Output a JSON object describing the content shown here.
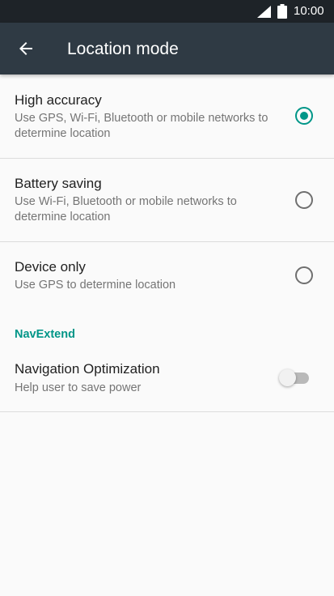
{
  "status_bar": {
    "time": "10:00",
    "icons": [
      "signal-icon",
      "battery-icon"
    ]
  },
  "app_bar": {
    "back_icon": "arrow-left-icon",
    "title": "Location mode"
  },
  "location_modes": [
    {
      "label": "High accuracy",
      "summary": "Use GPS, Wi-Fi, Bluetooth or mobile networks to determine location",
      "selected": true
    },
    {
      "label": "Battery saving",
      "summary": "Use Wi-Fi, Bluetooth or mobile networks to determine location",
      "selected": false
    },
    {
      "label": "Device only",
      "summary": "Use GPS to determine location",
      "selected": false
    }
  ],
  "navextend": {
    "header": "NavExtend",
    "item": {
      "label": "Navigation Optimization",
      "summary": "Help user to save power",
      "enabled": false
    }
  },
  "colors": {
    "accent": "#009688",
    "app_bar": "#2f3a44",
    "status_bar": "#1e2328",
    "background": "#fafafa"
  }
}
